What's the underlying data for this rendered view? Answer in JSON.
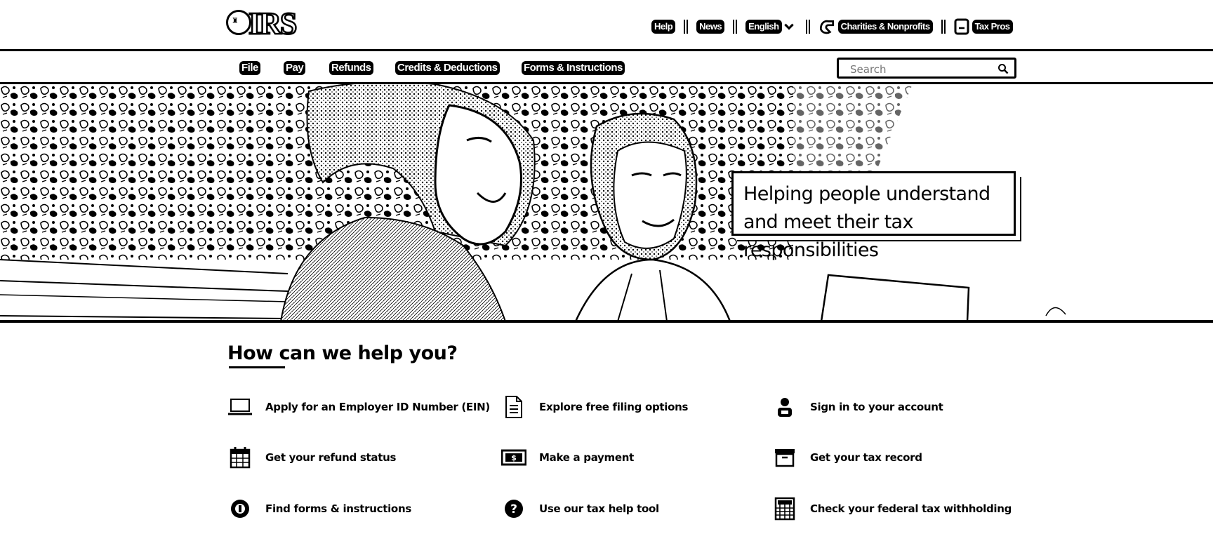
{
  "header": {
    "logo_text": "IRS",
    "utility_links": [
      {
        "label": "Help"
      },
      {
        "label": "News"
      },
      {
        "label": "English"
      },
      {
        "label": "Charities & Nonprofits"
      },
      {
        "label": "Tax Pros"
      }
    ]
  },
  "nav": {
    "items": [
      {
        "label": "File"
      },
      {
        "label": "Pay"
      },
      {
        "label": "Refunds"
      },
      {
        "label": "Credits & Deductions"
      },
      {
        "label": "Forms & Instructions"
      }
    ],
    "search": {
      "placeholder": "Search",
      "value": ""
    }
  },
  "hero": {
    "tagline": "Helping people understand and meet their tax responsibilities"
  },
  "help": {
    "title": "How can we help you?",
    "tiles": [
      {
        "label": "Apply for an Employer ID Number (EIN)",
        "icon": "laptop-icon"
      },
      {
        "label": "Explore free filing options",
        "icon": "document-icon"
      },
      {
        "label": "Sign in to your account",
        "icon": "user-icon"
      },
      {
        "label": "Get your refund status",
        "icon": "calendar-icon"
      },
      {
        "label": "Make a payment",
        "icon": "money-icon"
      },
      {
        "label": "Get your tax record",
        "icon": "archive-box-icon"
      },
      {
        "label": "Find forms & instructions",
        "icon": "info-circle-icon"
      },
      {
        "label": "Use our tax help tool",
        "icon": "question-circle-icon"
      },
      {
        "label": "Check your federal tax withholding",
        "icon": "calculator-icon"
      }
    ]
  }
}
